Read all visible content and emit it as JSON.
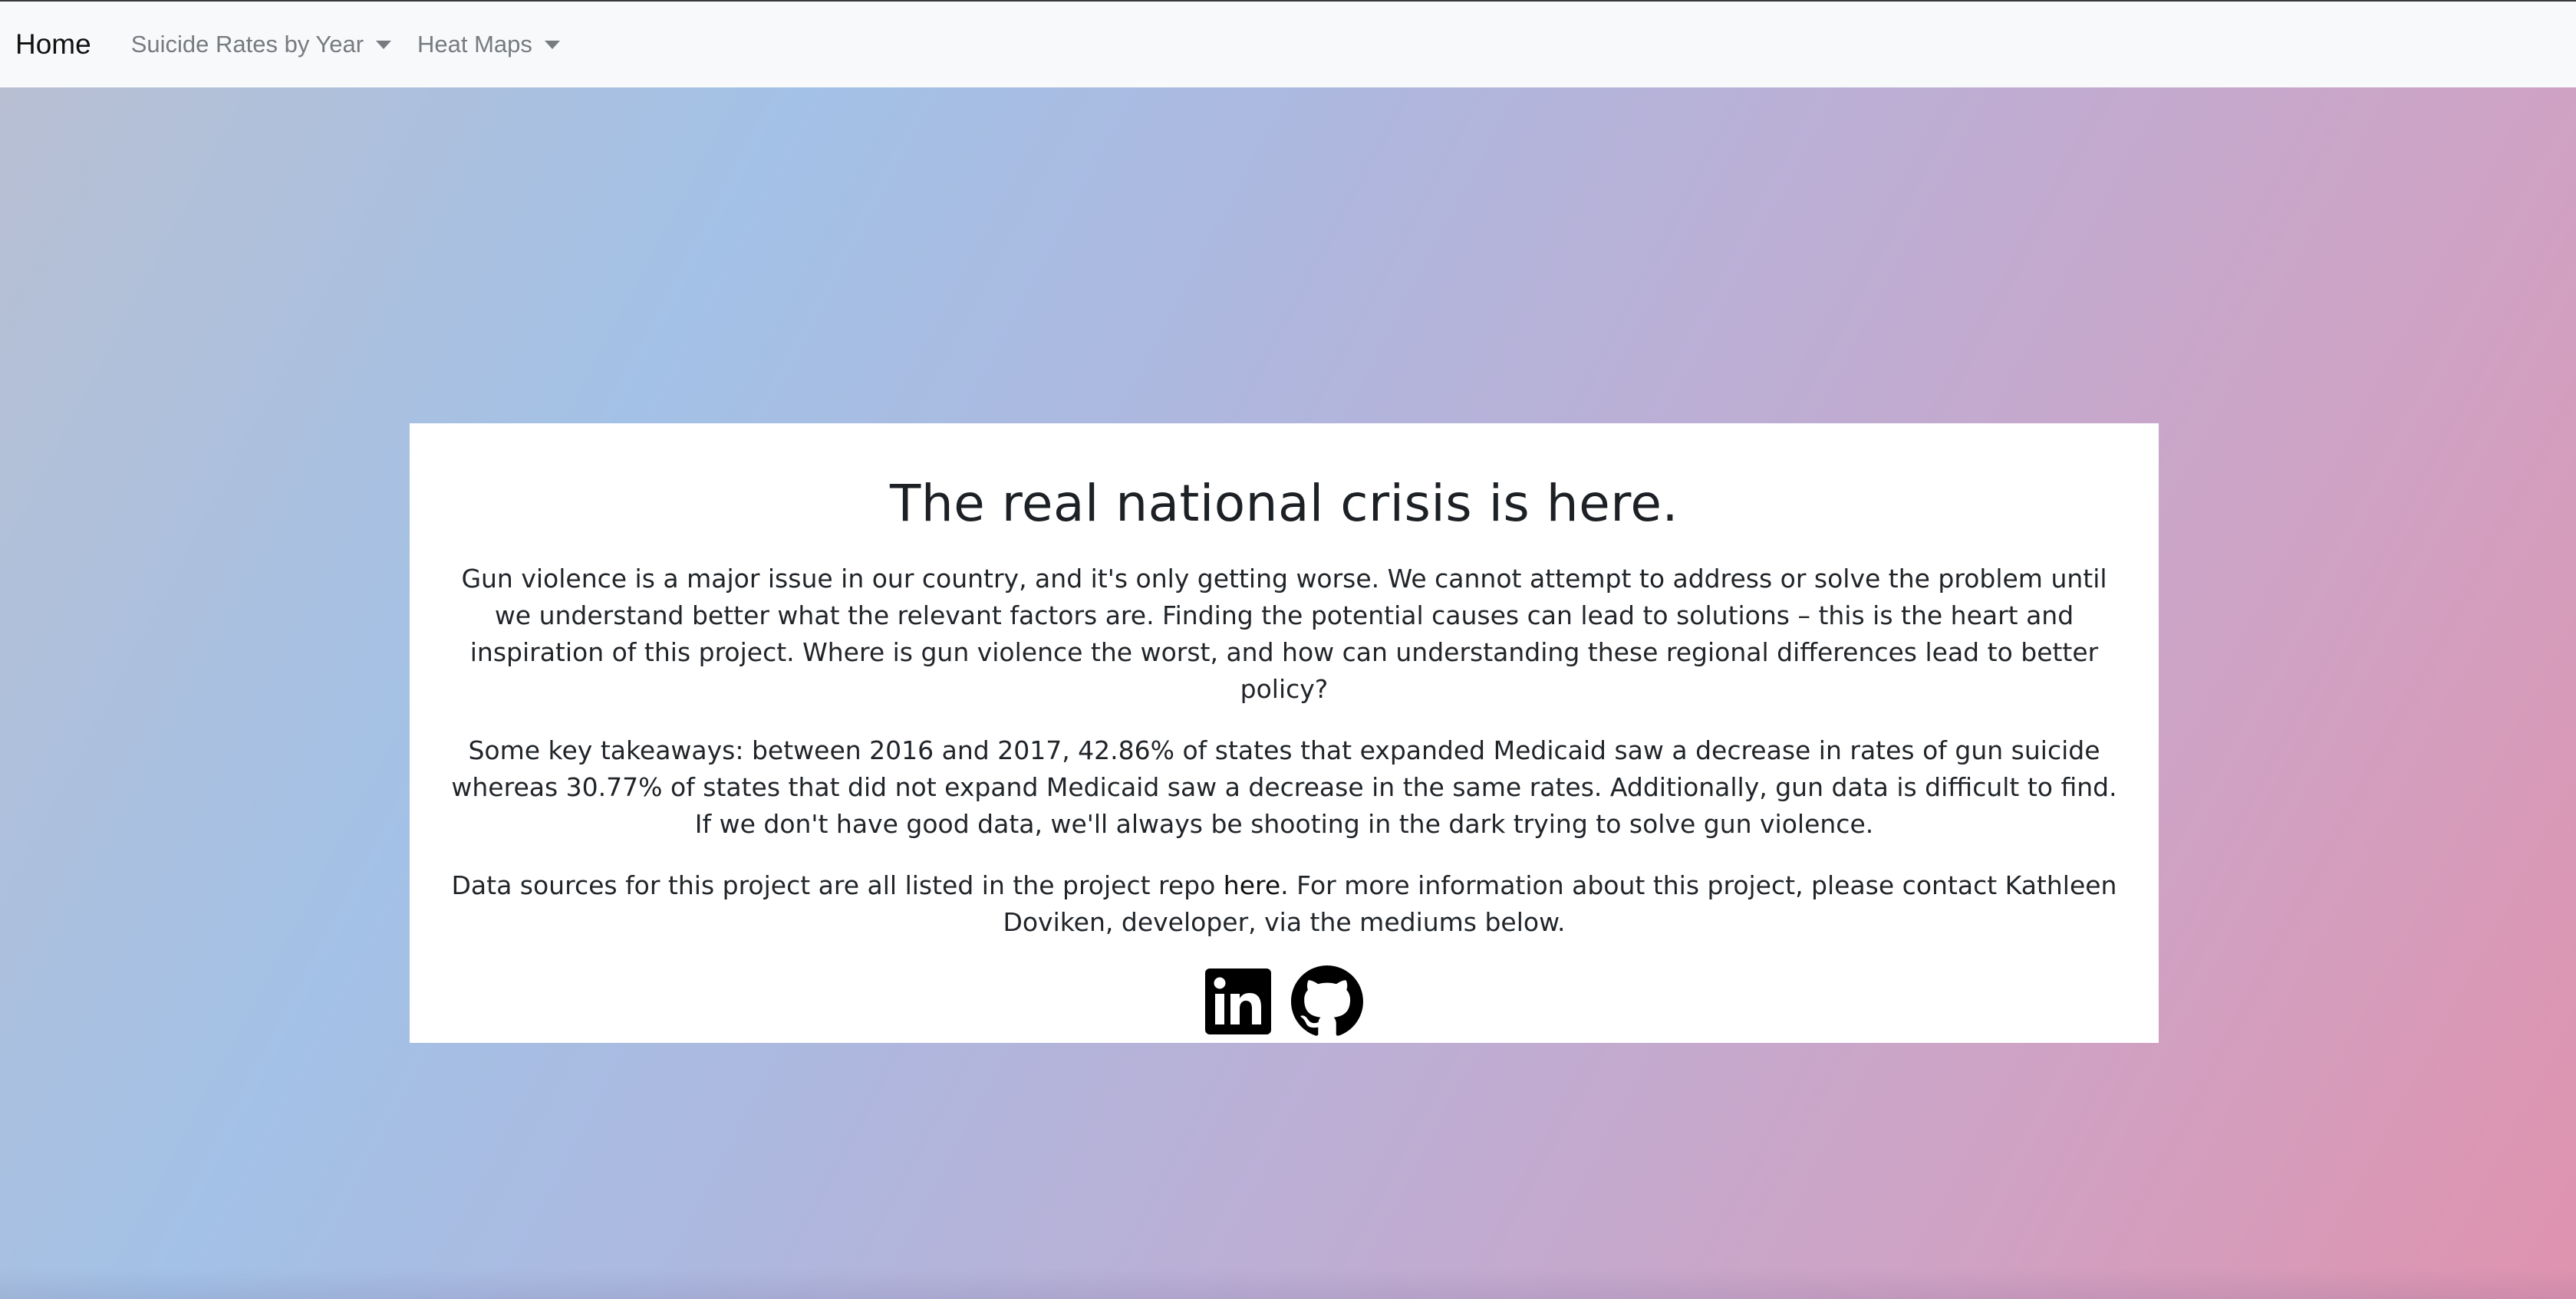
{
  "nav": {
    "brand": "Home",
    "items": [
      {
        "label": "Suicide Rates by Year"
      },
      {
        "label": "Heat Maps"
      }
    ]
  },
  "card": {
    "title": "The real national crisis is here.",
    "paragraph1": "Gun violence is a major issue in our country, and it's only getting worse. We cannot attempt to address or solve the problem until we understand better what the relevant factors are. Finding the potential causes can lead to solutions – this is the heart and inspiration of this project. Where is gun violence the worst, and how can understanding these regional differences lead to better policy?",
    "paragraph2": "Some key takeaways: between 2016 and 2017, 42.86% of states that expanded Medicaid saw a decrease in rates of gun suicide whereas 30.77% of states that did not expand Medicaid saw a decrease in the same rates. Additionally, gun data is difficult to find. If we don't have good data, we'll always be shooting in the dark trying to solve gun violence.",
    "paragraph3_before": "Data sources for this project are all listed in the project repo ",
    "paragraph3_link": "here",
    "paragraph3_after": ". For more information about this project, please contact Kathleen Doviken, developer, via the mediums below.",
    "icons": [
      "linkedin-icon",
      "github-icon"
    ]
  }
}
